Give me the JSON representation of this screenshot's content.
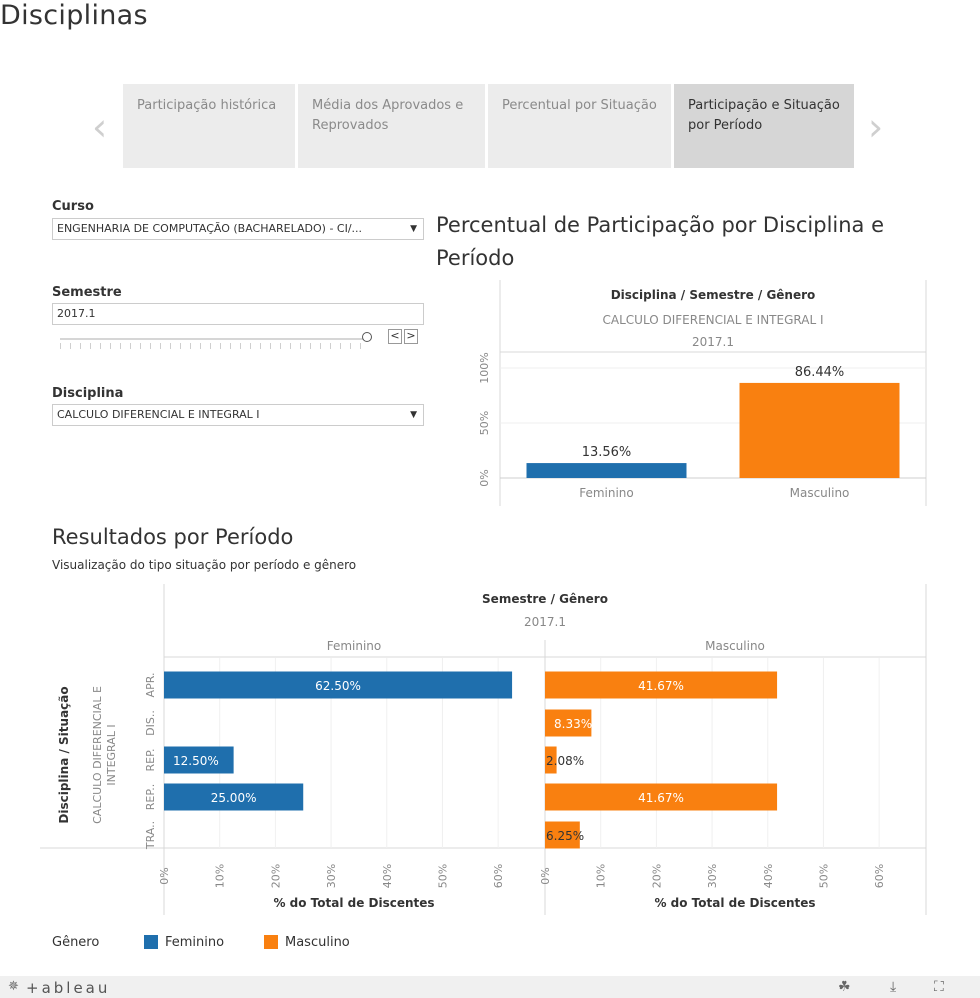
{
  "page": {
    "title": "Disciplinas"
  },
  "story": {
    "prev_icon": "chevron-left-icon",
    "next_icon": "chevron-right-icon",
    "tabs": [
      {
        "label": "Participação histórica",
        "active": false
      },
      {
        "label": "Média dos Aprovados e Reprovados",
        "active": false
      },
      {
        "label": "Percentual por Situação",
        "active": false
      },
      {
        "label": "Participação e Situação por Período",
        "active": true
      }
    ]
  },
  "filters": {
    "curso": {
      "label": "Curso",
      "value": "ENGENHARIA DE COMPUTAÇÃO (BACHARELADO) - CI/..."
    },
    "semestre": {
      "label": "Semestre",
      "value": "2017.1",
      "prev": "<",
      "next": ">"
    },
    "disciplina": {
      "label": "Disciplina",
      "value": "CALCULO DIFERENCIAL E INTEGRAL I"
    }
  },
  "chart1": {
    "title": "Percentual de Participação por Disciplina e Período",
    "header_title": "Disciplina / Semestre / Gênero",
    "header_sub1": "CALCULO DIFERENCIAL E INTEGRAL I",
    "header_sub2": "2017.1"
  },
  "chart2": {
    "title": "Resultados por Período",
    "subtitle": "Visualização do tipo  situação por período e gênero",
    "header_title": "Semestre / Gênero",
    "header_sub": "2017.1",
    "row_header": "Disciplina / Situação",
    "discipline_label": "CALCULO DIFERENCIAL E INTEGRAL I"
  },
  "legend": {
    "title": "Gênero",
    "items": [
      {
        "label": "Feminino",
        "color": "#1f6fad"
      },
      {
        "label": "Masculino",
        "color": "#f98010"
      }
    ]
  },
  "footer": {
    "logo": "+ableau",
    "icons": [
      "share-icon",
      "download-icon",
      "fullscreen-icon"
    ]
  },
  "chart_data": [
    {
      "type": "bar",
      "title": "Percentual de Participação por Disciplina e Período",
      "categories": [
        "Feminino",
        "Masculino"
      ],
      "values": [
        13.56,
        86.44
      ],
      "value_labels": [
        "13.56%",
        "86.44%"
      ],
      "colors": [
        "#1f6fad",
        "#f98010"
      ],
      "yticks": [
        "0%",
        "50%",
        "100%"
      ],
      "ylim": [
        0,
        100
      ],
      "grid": true
    },
    {
      "type": "bar",
      "orientation": "horizontal",
      "title": "Resultados por Período",
      "xlabel": "% do Total de Discentes",
      "panels": [
        "Feminino",
        "Masculino"
      ],
      "categories": [
        "APR.",
        "DIS..",
        "REP.",
        "REP..",
        "TRA.."
      ],
      "series": [
        {
          "name": "Feminino",
          "color": "#1f6fad",
          "values": [
            62.5,
            null,
            12.5,
            25.0,
            null
          ],
          "labels": [
            "62.50%",
            "",
            "12.50%",
            "25.00%",
            ""
          ]
        },
        {
          "name": "Masculino",
          "color": "#f98010",
          "values": [
            41.67,
            8.33,
            2.08,
            41.67,
            6.25
          ],
          "labels": [
            "41.67%",
            "8.33%",
            "2.08%",
            "41.67%",
            "6.25%"
          ]
        }
      ],
      "xticks": [
        "0%",
        "10%",
        "20%",
        "30%",
        "40%",
        "50%",
        "60%"
      ],
      "xlim": [
        0,
        65
      ],
      "grid": true
    }
  ]
}
